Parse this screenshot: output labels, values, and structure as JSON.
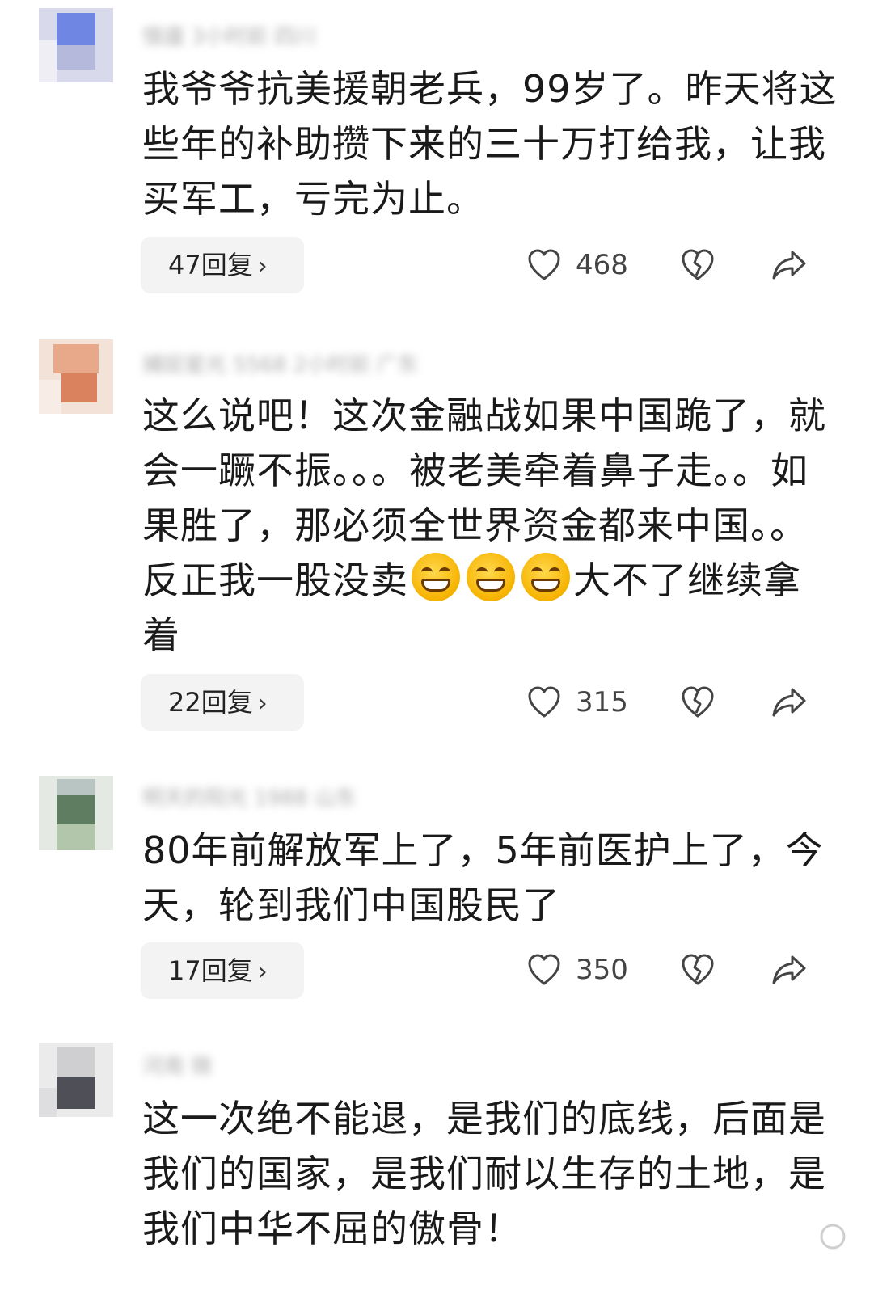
{
  "comments": [
    {
      "username": "憶廬 3小时前 四川",
      "text": "我爷爷抗美援朝老兵，99岁了。昨天将这些年的补助攒下来的三十万打给我，让我买军工，亏完为止。",
      "reply_label": "47回复",
      "likes": "468"
    },
    {
      "username": "捕捉星光 5568 2小时前 广东",
      "text_before": "这么说吧！这次金融战如果中国跪了，就会一蹶不振。。。被老美牵着鼻子走。。如果胜了，那必须全世界资金都来中国。。反正我一股没卖",
      "text_after": "大不了继续拿着",
      "emoji": "grinning-face",
      "reply_label": "22回复",
      "likes": "315"
    },
    {
      "username": "明天的阳光 1988 山东",
      "text": "80年前解放军上了，5年前医护上了，今天，轮到我们中国股民了",
      "reply_label": "17回复",
      "likes": "350"
    },
    {
      "username": "河南 微",
      "text": "这一次绝不能退，是我们的底线，后面是我们的国家，是我们耐以生存的土地，是我们中华不屈的傲骨！"
    }
  ],
  "icons": {
    "like": "heart-outline-icon",
    "dislike": "broken-heart-icon",
    "share": "share-arrow-icon",
    "reply_more": "chevron-right-icon"
  }
}
